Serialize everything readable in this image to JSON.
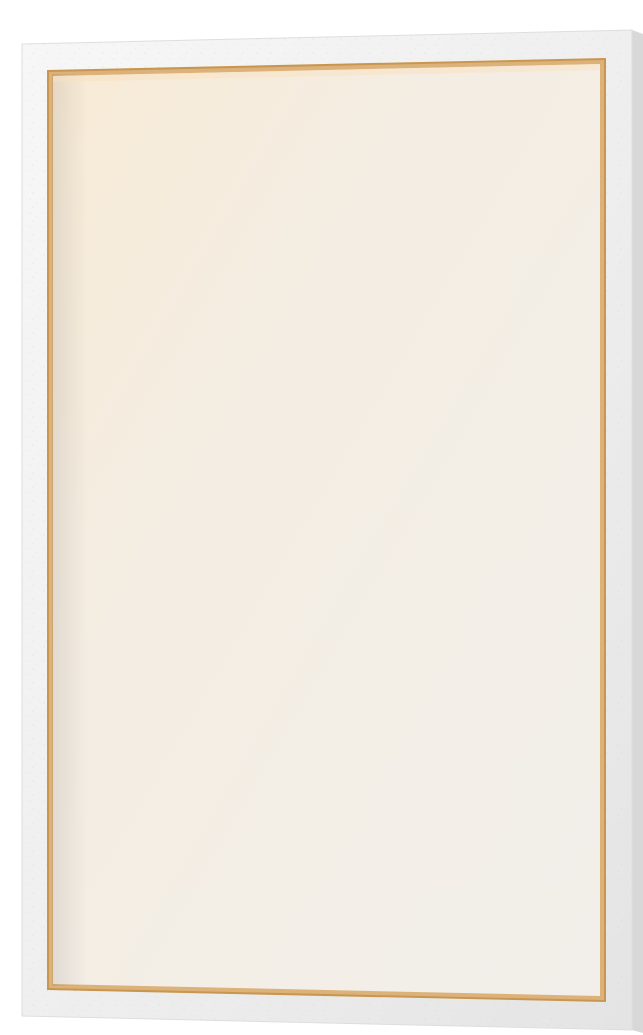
{
  "scene": {
    "subject": "blank-picture-frame",
    "colors": {
      "background": "#ffffff",
      "frame": "#efefef",
      "frame_shadow": "#d9d9d9",
      "frame_highlight": "#f9f9f9",
      "inner_edge": "#c8964e",
      "inner_edge_light": "#dcb27a",
      "canvas": "#f3efe8",
      "canvas_warm": "#f6ead9"
    }
  }
}
